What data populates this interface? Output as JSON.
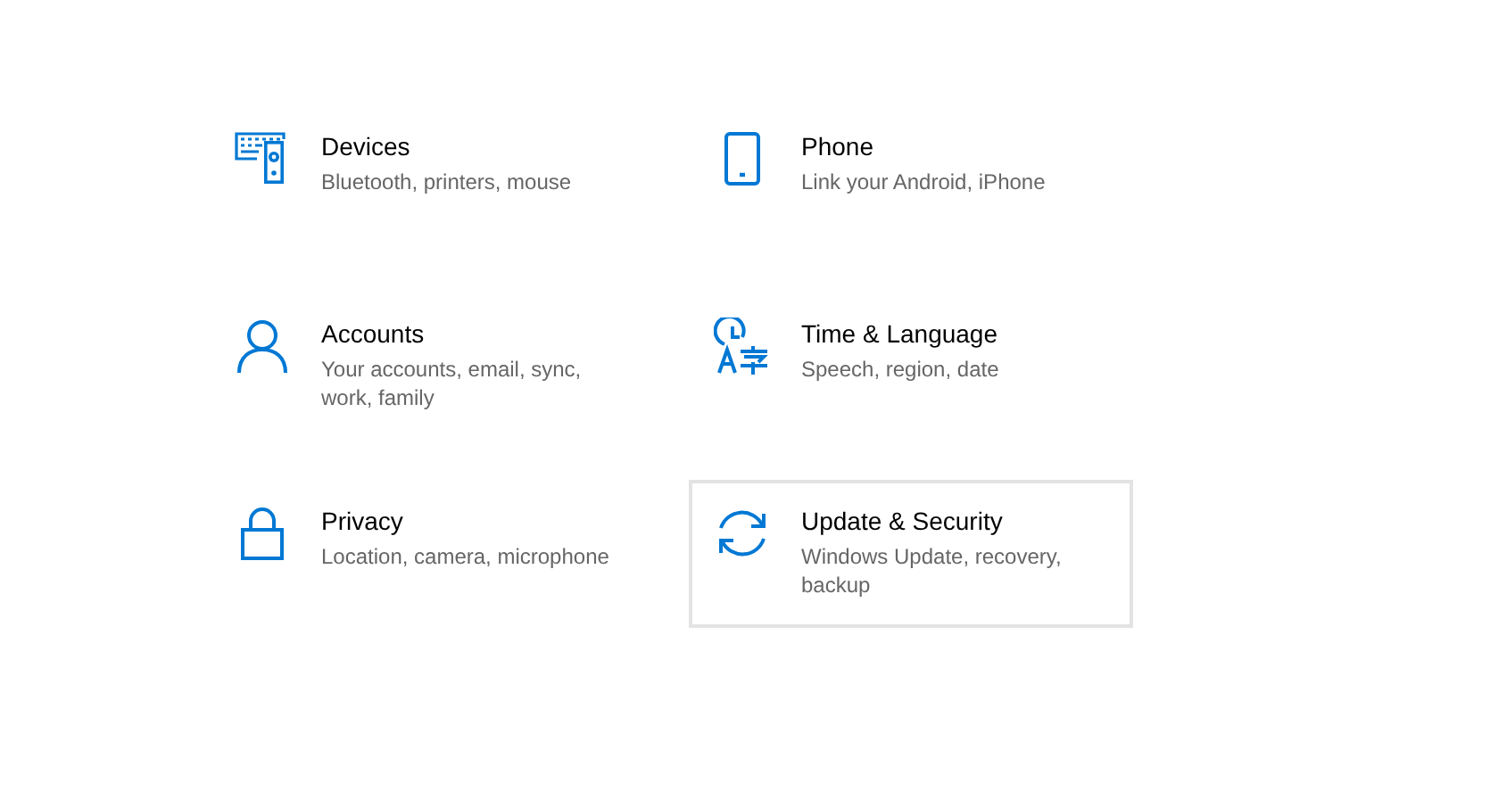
{
  "tiles": [
    {
      "kind": "devices",
      "title": "Devices",
      "description": "Bluetooth, printers, mouse",
      "selected": false
    },
    {
      "kind": "phone",
      "title": "Phone",
      "description": "Link your Android, iPhone",
      "selected": false
    },
    {
      "kind": "accounts",
      "title": "Accounts",
      "description": "Your accounts, email, sync, work, family",
      "selected": false
    },
    {
      "kind": "time",
      "title": "Time & Language",
      "description": "Speech, region, date",
      "selected": false
    },
    {
      "kind": "privacy",
      "title": "Privacy",
      "description": "Location, camera, microphone",
      "selected": false
    },
    {
      "kind": "update",
      "title": "Update & Security",
      "description": "Windows Update, recovery, backup",
      "selected": true
    }
  ]
}
